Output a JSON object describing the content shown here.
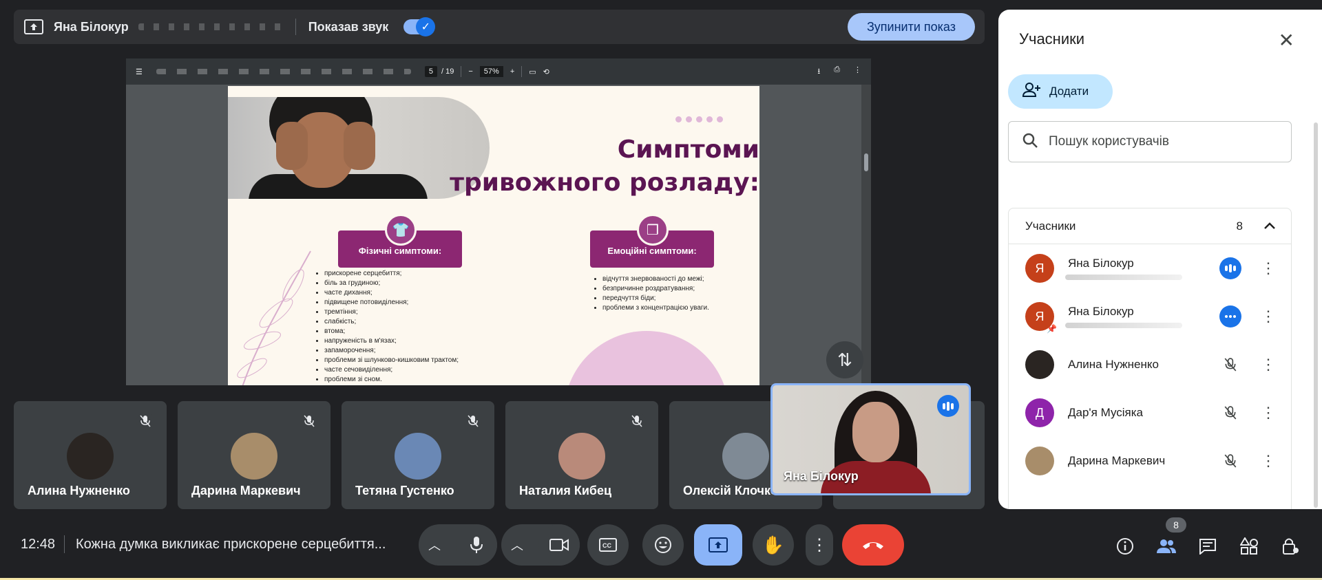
{
  "present_bar": {
    "presenter_name": "Яна Білокур",
    "sound_label": "Показав звук",
    "stop_button": "Зупинити показ"
  },
  "pdf_toolbar": {
    "page_current": "5",
    "page_total": "/ 19",
    "zoom": "57%"
  },
  "slide": {
    "title_line1": "Симптоми",
    "title_line2": "тривожного розладу:",
    "physical_title": "Фізичні симптоми:",
    "emotional_title": "Емоційні симптоми:",
    "physical_list": [
      "прискорене серцебиття;",
      "біль за грудиною;",
      "часте дихання;",
      "підвищене потовиділення;",
      "тремтіння;",
      "слабкість;",
      "втома;",
      "напруженість в м'язах;",
      "запаморочення;",
      "проблеми зі шлунково-кишковим трактом;",
      "часте сечовиділення;",
      "проблеми зі сном."
    ],
    "emotional_list": [
      "відчуття знервованості до межі;",
      "безпричинне роздратування;",
      "передчуття біди;",
      "проблеми з концентрацією уваги."
    ]
  },
  "tiles": [
    {
      "name": "Алина Нужненко",
      "color": "#2a2522"
    },
    {
      "name": "Дарина Маркевич",
      "color": "#a88d6a"
    },
    {
      "name": "Тетяна Густенко",
      "color": "#6a88b5"
    },
    {
      "name": "Наталия Кибец",
      "color": "#b98a7a"
    },
    {
      "name": "Олексій Клочко",
      "color": "#7f8a95"
    }
  ],
  "self_tile": {
    "name": "Яна Білокур"
  },
  "panel": {
    "title": "Учасники",
    "add_button": "Додати",
    "search_placeholder": "Пошук користувачів",
    "list_title": "Учасники",
    "count": "8",
    "participants": [
      {
        "name": "Яна Білокур",
        "initial": "Я",
        "color": "#c5401a",
        "status": "speaking"
      },
      {
        "name": "Яна Білокур",
        "initial": "Я",
        "color": "#c5401a",
        "status": "speaking",
        "pinned": true
      },
      {
        "name": "Алина Нужненко",
        "initial": "",
        "color": "#2a2522",
        "status": "muted"
      },
      {
        "name": "Дар'я Мусіяка",
        "initial": "Д",
        "color": "#8e24aa",
        "status": "muted"
      },
      {
        "name": "Дарина Маркевич",
        "initial": "",
        "color": "#a88d6a",
        "status": "muted"
      }
    ]
  },
  "bottom": {
    "time": "12:48",
    "caption": "Кожна думка викликає прискорене серцебиття...",
    "people_badge": "8"
  }
}
